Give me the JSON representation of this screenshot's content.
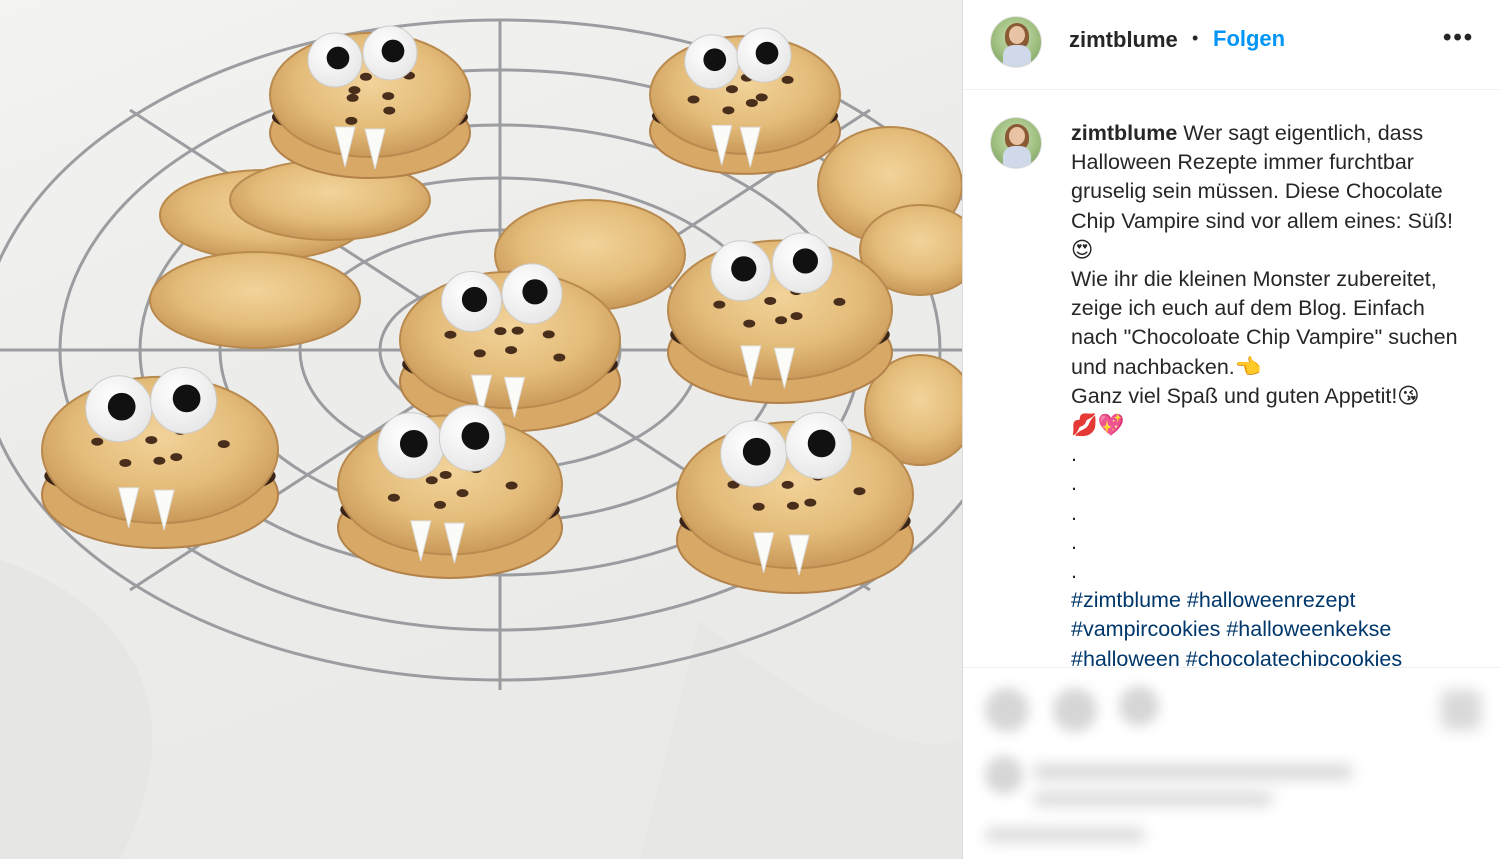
{
  "post": {
    "image_alt": "Chocolate Chip Vampire Kekse auf einem Kuchengitter"
  },
  "header": {
    "username": "zimtblume",
    "separator": "•",
    "follow_label": "Folgen",
    "more_icon": "more-horizontal-icon",
    "more_glyph": "•••"
  },
  "caption": {
    "username": "zimtblume",
    "text": " Wer sagt eigentlich, dass Halloween Rezepte immer furchtbar gruselig sein müssen. Diese Chocolate Chip Vampire sind vor allem eines: Süß! 😍⠀⠀⠀⠀⠀⠀⠀⠀⠀⠀⠀⠀\nWie ihr die kleinen Monster zubereitet, zeige ich euch auf dem Blog. Einfach nach \"Chocoloate Chip Vampire\" suchen und nachbacken.👈\nGanz viel Spaß und guten Appetit!😘\n💋💖⠀⠀⠀⠀⠀⠀⠀⠀⠀⠀⠀⠀⠀⠀\n.⠀⠀⠀⠀⠀⠀⠀⠀⠀⠀⠀⠀⠀\n.⠀⠀⠀⠀⠀⠀⠀⠀⠀⠀⠀⠀⠀\n.⠀⠀⠀⠀⠀⠀⠀⠀⠀⠀⠀⠀⠀\n.⠀⠀⠀⠀⠀⠀⠀⠀⠀⠀⠀⠀⠀\n.⠀⠀⠀⠀⠀⠀⠀⠀⠀⠀⠀⠀⠀",
    "hashtags": "#zimtblume #halloweenrezept #vampircookies #halloweenkekse #halloween #chocolatechipcookies"
  },
  "colors": {
    "link_blue": "#0095f6",
    "hashtag_blue": "#00376b",
    "text": "#262626"
  }
}
